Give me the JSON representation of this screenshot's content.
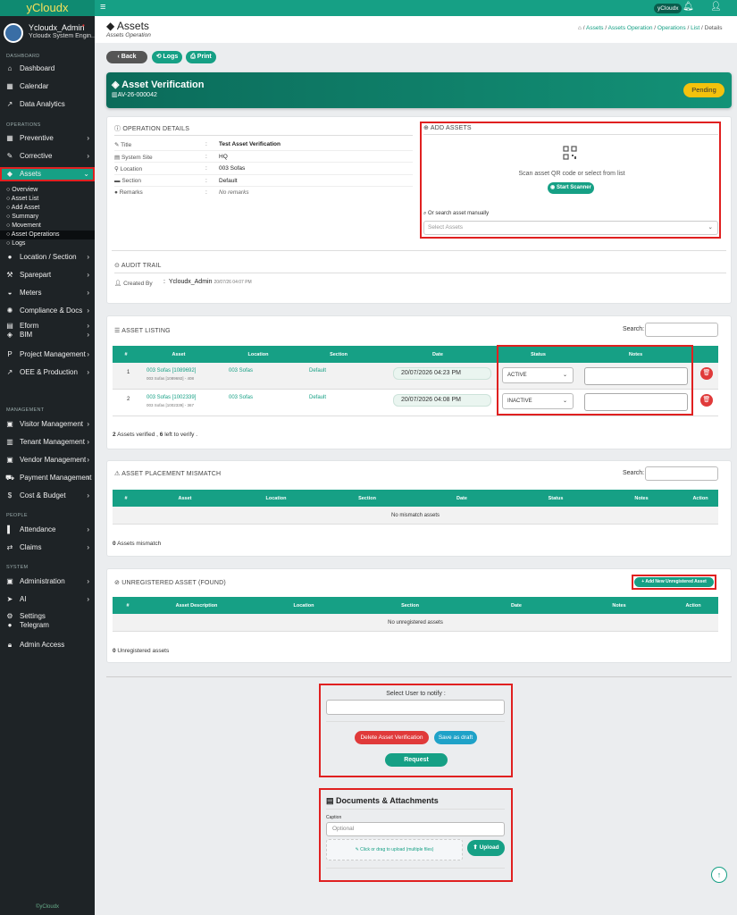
{
  "brand": "yCloudx",
  "header": {
    "badge": "yCloudx"
  },
  "profile": {
    "name": "Ycloudx_Admin",
    "role": "Ycloudx System Engin..."
  },
  "sidebar": {
    "sec_dashboard": "DASHBOARD",
    "dashboard": "Dashboard",
    "calendar": "Calendar",
    "analytics": "Data Analytics",
    "sec_operations": "OPERATIONS",
    "preventive": "Preventive",
    "corrective": "Corrective",
    "assets": "Assets",
    "sub": [
      "Overview",
      "Asset List",
      "Add Asset",
      "Summary",
      "Movement",
      "Asset Operations",
      "Logs"
    ],
    "location": "Location / Section",
    "sparepart": "Sparepart",
    "meters": "Meters",
    "compliance": "Compliance & Docs",
    "eform": "Eform",
    "bim": "BIM",
    "project": "Project Management",
    "oee": "OEE & Production",
    "sec_management": "MANAGEMENT",
    "visitor": "Visitor Management",
    "tenant": "Tenant Management",
    "vendor": "Vendor Management",
    "payment": "Payment Management",
    "cost": "Cost & Budget",
    "sec_people": "PEOPLE",
    "attendance": "Attendance",
    "claims": "Claims",
    "sec_system": "SYSTEM",
    "admin": "Administration",
    "ai": "AI",
    "settings": "Settings",
    "telegram": "Telegram",
    "access": "Admin Access",
    "footer": "©yCloudx"
  },
  "page": {
    "title": "Assets",
    "subtitle": "Assets Operation",
    "breadcrumb": [
      "Assets",
      "Assets Operation",
      "Operations",
      "List",
      "Details"
    ]
  },
  "buttons": {
    "back": "Back",
    "logs": "Logs",
    "print": "Print"
  },
  "banner": {
    "title": "Asset Verification",
    "code": "AV-26-000042",
    "status": "Pending"
  },
  "operation": {
    "heading": "OPERATION DETAILS",
    "rows": [
      {
        "label": "Title",
        "value": "Test Asset Verification"
      },
      {
        "label": "System Site",
        "value": "HQ"
      },
      {
        "label": "Location",
        "value": "003 Sofas"
      },
      {
        "label": "Section",
        "value": "Default"
      },
      {
        "label": "Remarks",
        "value": "No remarks"
      }
    ]
  },
  "add_assets": {
    "heading": "ADD ASSETS",
    "scan_text": "Scan asset QR code or select from list",
    "scanner_btn": "Start Scanner",
    "manual_label": "Or search asset manually",
    "select_placeholder": "Select Assets"
  },
  "audit": {
    "heading": "AUDIT TRAIL",
    "created_by_label": "Created By",
    "created_by": "Ycloudx_Admin",
    "created_at": "20/07/26 04:07 PM"
  },
  "listing": {
    "heading": "ASSET LISTING",
    "search_label": "Search:",
    "columns": [
      "#",
      "Asset",
      "Location",
      "Section",
      "Date",
      "Status",
      "Notes"
    ],
    "rows": [
      {
        "num": "1",
        "asset": "003 Sofas [1089692]",
        "asset_sub": "003 Sofas [1089692] - 408",
        "location": "003 Sofas",
        "section": "Default",
        "date": "20/07/2026 04:23 PM",
        "status": "ACTIVE"
      },
      {
        "num": "2",
        "asset": "003 Sofas [1002339]",
        "asset_sub": "003 Sofas [1002339] - 367",
        "location": "003 Sofas",
        "section": "Default",
        "date": "20/07/2026 04:08 PM",
        "status": "INACTIVE"
      }
    ],
    "summary_count": "2",
    "summary_text1": " Assets verified , ",
    "summary_left": "6",
    "summary_text2": " left to verify ."
  },
  "mismatch": {
    "heading": "ASSET PLACEMENT MISMATCH",
    "search_label": "Search:",
    "columns": [
      "#",
      "Asset",
      "Location",
      "Section",
      "Date",
      "Status",
      "Notes",
      "Action"
    ],
    "empty": "No mismatch assets",
    "summary_count": "0",
    "summary_text": " Assets mismatch"
  },
  "unregistered": {
    "heading": "UNREGISTERED ASSET (FOUND)",
    "add_btn": "Add New Unregistered Asset",
    "columns": [
      "#",
      "Asset Description",
      "Location",
      "Section",
      "Date",
      "Notes",
      "Action"
    ],
    "empty": "No unregistered assets",
    "summary_count": "0",
    "summary_text": " Unregistered assets"
  },
  "notify": {
    "label": "Select User to notify :",
    "delete_btn": "Delete Asset Verification",
    "draft_btn": "Save as draft",
    "request_btn": "Request"
  },
  "documents": {
    "heading": "Documents & Attachments",
    "caption_label": "Caption",
    "caption_placeholder": "Optional",
    "drop_text": "Click or drag to upload (multiple files)",
    "upload_btn": "Upload"
  },
  "colors": {
    "primary": "#16a085",
    "danger": "#e03a3a",
    "warning": "#f4c20d",
    "highlight": "#e02020"
  }
}
